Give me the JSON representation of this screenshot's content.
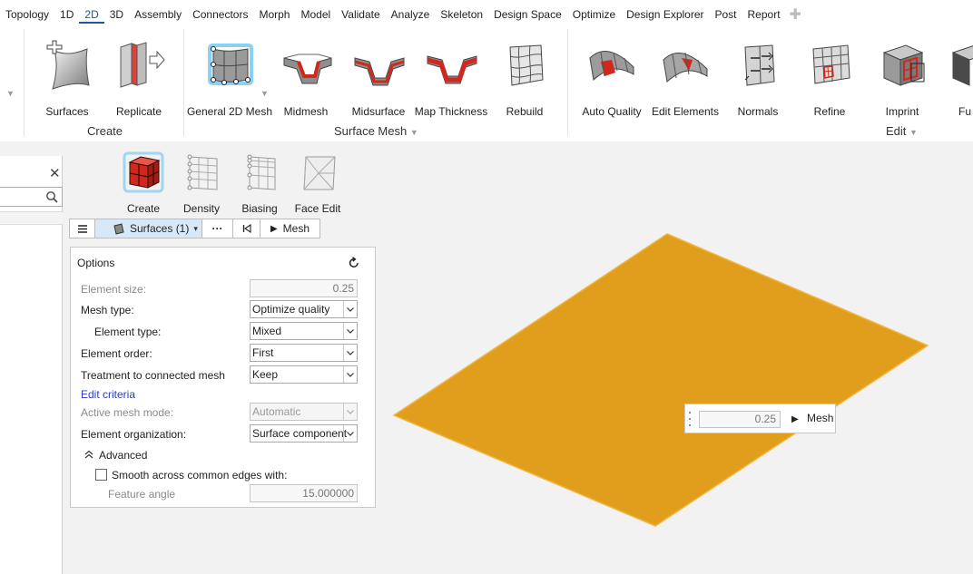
{
  "menu": {
    "items": [
      "Topology",
      "1D",
      "2D",
      "3D",
      "Assembly",
      "Connectors",
      "Morph",
      "Model",
      "Validate",
      "Analyze",
      "Skeleton",
      "Design Space",
      "Optimize",
      "Design Explorer",
      "Post",
      "Report"
    ],
    "active": "2D"
  },
  "ribbon": {
    "create_group": {
      "label": "Create",
      "buttons": [
        "Surfaces",
        "Replicate"
      ]
    },
    "surface_mesh_group": {
      "label": "Surface Mesh",
      "buttons": [
        "General 2D Mesh",
        "Midmesh",
        "Midsurface",
        "Map Thickness",
        "Rebuild"
      ]
    },
    "edit_group": {
      "label": "Edit",
      "buttons": [
        "Auto Quality",
        "Edit Elements",
        "Normals",
        "Refine",
        "Imprint",
        "Fu"
      ]
    }
  },
  "subtools": [
    "Create",
    "Density",
    "Biasing",
    "Face Edit"
  ],
  "guidebar": {
    "selection": "Surfaces (1)",
    "more": "···",
    "mesh_button": "Mesh"
  },
  "options": {
    "title": "Options",
    "element_size": {
      "label": "Element size:",
      "value": "0.25"
    },
    "mesh_type": {
      "label": "Mesh type:",
      "value": "Optimize quality"
    },
    "element_type": {
      "label": "Element type:",
      "value": "Mixed"
    },
    "element_order": {
      "label": "Element order:",
      "value": "First"
    },
    "treatment": {
      "label": "Treatment to connected mesh",
      "value": "Keep"
    },
    "edit_criteria": "Edit criteria",
    "active_mesh_mode": {
      "label": "Active mesh mode:",
      "value": "Automatic"
    },
    "element_organization": {
      "label": "Element organization:",
      "value": "Surface component"
    },
    "advanced": "Advanced",
    "smooth": "Smooth across common edges with:",
    "feature_angle": {
      "label": "Feature angle",
      "value": "15.000000"
    }
  },
  "mesh_mini": {
    "value": "0.25",
    "button": "Mesh"
  },
  "colors": {
    "surface": "#e09e1c",
    "accent": "#1a57a8",
    "highlight": "#3ab4f2",
    "cube_red": "#d0281c"
  }
}
